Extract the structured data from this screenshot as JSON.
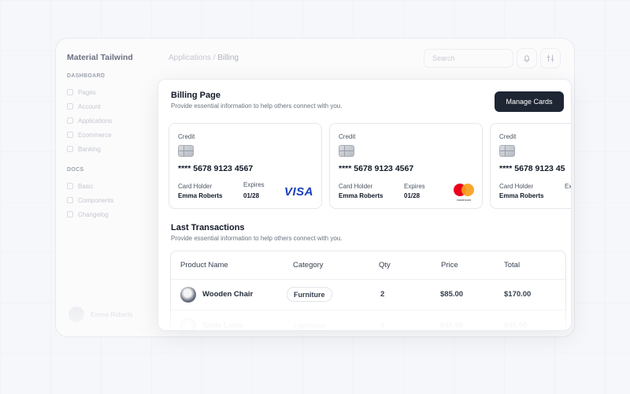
{
  "sidebar": {
    "brand": "Material Tailwind",
    "sections": [
      {
        "heading": "DASHBOARD",
        "items": [
          "Pages",
          "Account",
          "Applications",
          "Ecommerce",
          "Banking"
        ]
      },
      {
        "heading": "DOCS",
        "items": [
          "Basic",
          "Components",
          "Changelog"
        ]
      }
    ],
    "user_name": "Emma Roberts"
  },
  "topbar": {
    "breadcrumb_parent": "Applications",
    "breadcrumb_sep": " / ",
    "breadcrumb_current": "Billing",
    "search_placeholder": "Search"
  },
  "billing": {
    "title": "Billing Page",
    "subtitle": "Provide essential information to help others connect with you.",
    "manage_button": "Manage Cards",
    "cards": [
      {
        "type": "Credit",
        "number": "**** 5678 9123 4567",
        "holder_label": "Card Holder",
        "holder": "Emma Roberts",
        "expires_label": "Expires",
        "expires": "01/28",
        "brand": "VISA",
        "brand_icon": "visa-logo"
      },
      {
        "type": "Credit",
        "number": "**** 5678 9123 4567",
        "holder_label": "Card Holder",
        "holder": "Emma Roberts",
        "expires_label": "Expires",
        "expires": "01/28",
        "brand": "mastercard",
        "brand_icon": "mastercard-logo"
      },
      {
        "type": "Credit",
        "number": "**** 5678 9123 45",
        "holder_label": "Card Holder",
        "holder": "Emma Roberts",
        "expires_label": "Ex",
        "expires": "",
        "brand": "",
        "brand_icon": ""
      }
    ]
  },
  "transactions": {
    "title": "Last Transactions",
    "subtitle": "Provide essential information to help others connect with you.",
    "columns": [
      "Product Name",
      "Category",
      "Qty",
      "Price",
      "Total"
    ],
    "rows": [
      {
        "product": "Wooden Chair",
        "category": "Furniture",
        "qty": "2",
        "price": "$85.00",
        "total": "$170.00"
      },
      {
        "product": "Table Lamp",
        "category": "Lightning",
        "qty": "1",
        "price": "$45.00",
        "total": "$45.00"
      }
    ]
  },
  "colors": {
    "primary_button": "#1e2533",
    "visa_blue": "#1a3fbf",
    "mc_red": "#eb001b",
    "mc_orange": "#f79e1b"
  }
}
